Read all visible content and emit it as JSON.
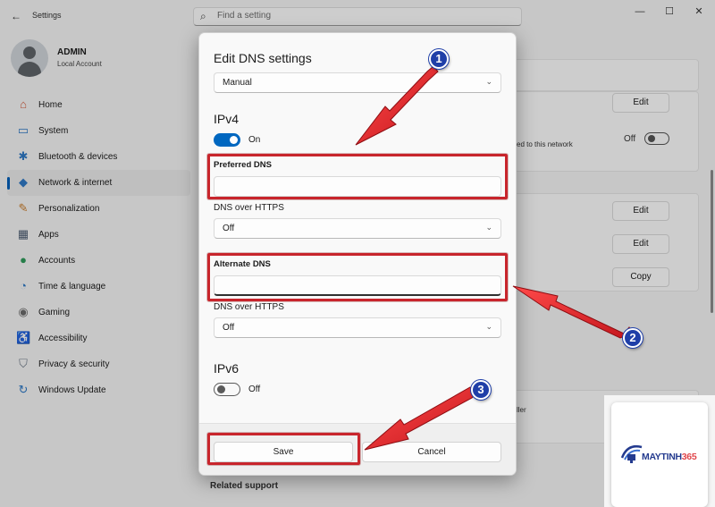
{
  "window": {
    "title": "Settings",
    "search_placeholder": "Find a setting",
    "back": "←",
    "minimize": "—",
    "maximize": "☐",
    "close": "✕"
  },
  "profile": {
    "name": "ADMIN",
    "account_type": "Local Account"
  },
  "sidebar": {
    "items": [
      {
        "label": "Home",
        "icon": "home-icon",
        "glyph": "⌂",
        "color": "#d15b3c"
      },
      {
        "label": "System",
        "icon": "monitor-icon",
        "glyph": "▭",
        "color": "#2f78c4"
      },
      {
        "label": "Bluetooth & devices",
        "icon": "bluetooth-icon",
        "glyph": "✱",
        "color": "#2f78c4"
      },
      {
        "label": "Network & internet",
        "icon": "wifi-icon",
        "glyph": "◆",
        "color": "#2f78c4",
        "active": true
      },
      {
        "label": "Personalization",
        "icon": "brush-icon",
        "glyph": "✎",
        "color": "#c77b2b"
      },
      {
        "label": "Apps",
        "icon": "apps-icon",
        "glyph": "▦",
        "color": "#4a5a70"
      },
      {
        "label": "Accounts",
        "icon": "person-icon",
        "glyph": "●",
        "color": "#2f9a5a"
      },
      {
        "label": "Time & language",
        "icon": "globe-clock-icon",
        "glyph": "◔",
        "color": "#2f78c4"
      },
      {
        "label": "Gaming",
        "icon": "gamepad-icon",
        "glyph": "◉",
        "color": "#6b6b6b"
      },
      {
        "label": "Accessibility",
        "icon": "accessibility-icon",
        "glyph": "♿",
        "color": "#2f78c4"
      },
      {
        "label": "Privacy & security",
        "icon": "shield-icon",
        "glyph": "⛉",
        "color": "#6b7785"
      },
      {
        "label": "Windows Update",
        "icon": "update-icon",
        "glyph": "↻",
        "color": "#2f78c4"
      }
    ]
  },
  "background": {
    "edit_label": "Edit",
    "copy_label": "Copy",
    "network_note": "ed to this network",
    "toggle_state": "Off",
    "partial_text": "ller",
    "related_support": "Related support"
  },
  "dialog": {
    "title": "Edit DNS settings",
    "mode_value": "Manual",
    "ipv4": {
      "heading": "IPv4",
      "toggle_label": "On",
      "preferred_label": "Preferred DNS",
      "preferred_value": "",
      "preferred_https_label": "DNS over HTTPS",
      "preferred_https_value": "Off",
      "alternate_label": "Alternate DNS",
      "alternate_value": "",
      "alternate_https_label": "DNS over HTTPS",
      "alternate_https_value": "Off"
    },
    "ipv6": {
      "heading": "IPv6",
      "toggle_label": "Off"
    },
    "save_label": "Save",
    "cancel_label": "Cancel"
  },
  "annotations": {
    "badge_1": "1",
    "badge_2": "2",
    "badge_3": "3",
    "highlight_color": "#c8252c",
    "badge_color": "#1f3fa8"
  },
  "watermark": {
    "brand": "MAYTINH",
    "brand_number": "365"
  }
}
